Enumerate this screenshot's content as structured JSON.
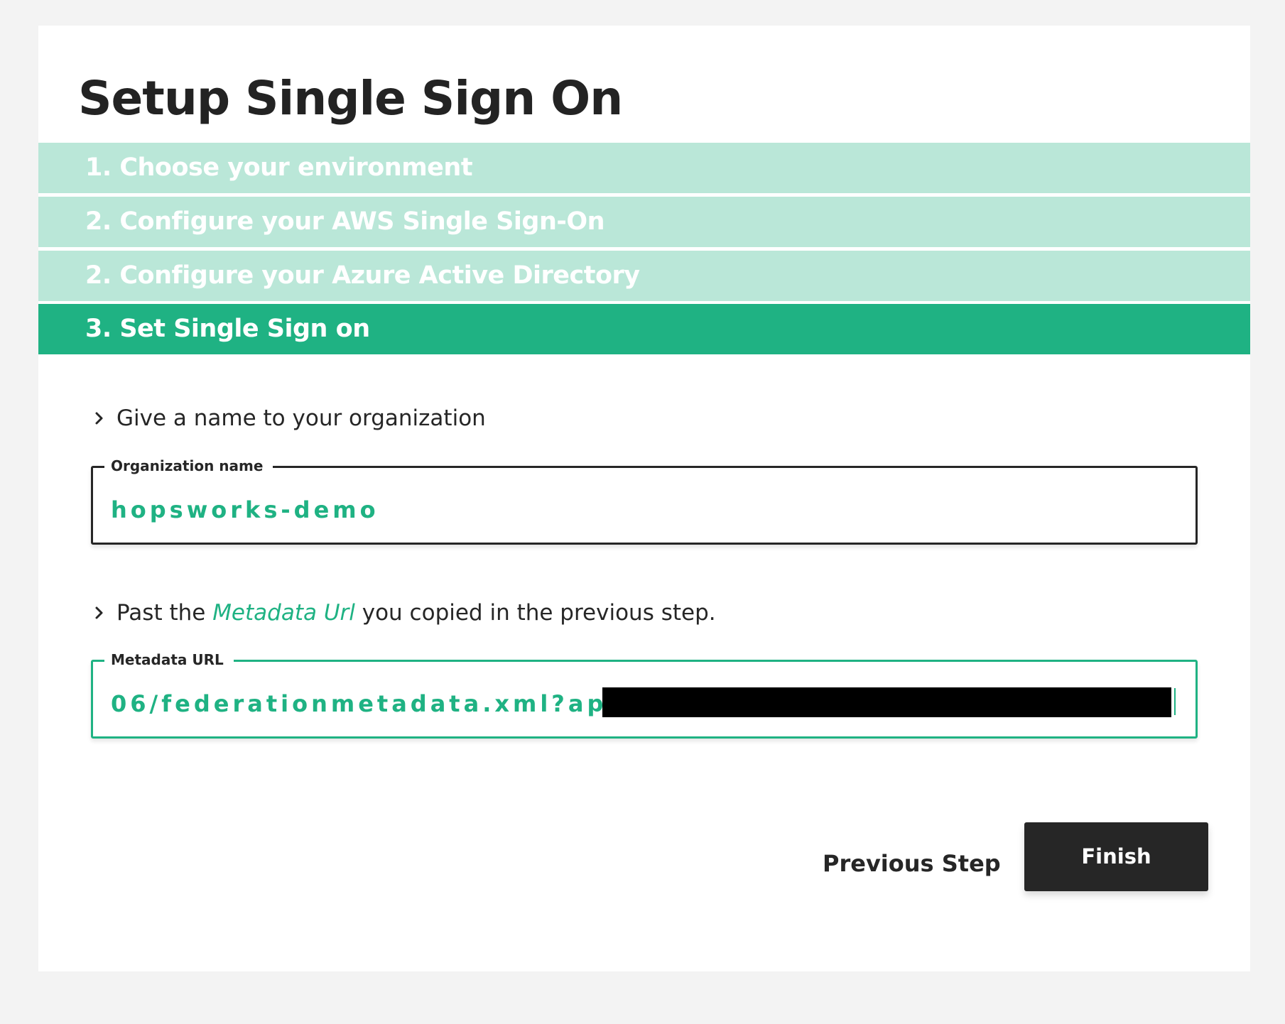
{
  "page": {
    "title": "Setup Single Sign On"
  },
  "steps": [
    {
      "label": "1. Choose your environment",
      "state": "inactive"
    },
    {
      "label": "2. Configure your AWS Single Sign-On",
      "state": "inactive"
    },
    {
      "label": "2. Configure your Azure Active Directory",
      "state": "inactive"
    },
    {
      "label": "3. Set Single Sign on",
      "state": "active"
    }
  ],
  "org_section": {
    "instruction": "Give a name to your organization",
    "field_label": "Organization name",
    "field_value": "hopsworks-demo"
  },
  "metadata_section": {
    "instruction_before": "Past the ",
    "instruction_highlight": "Metadata Url",
    "instruction_after": " you copied in the previous step.",
    "field_label": "Metadata URL",
    "field_value": "06/federationmetadata.xml?appid=a"
  },
  "actions": {
    "previous_label": "Previous Step",
    "finish_label": "Finish"
  },
  "icons": {
    "instruction_marker": "chevron-right-icon"
  },
  "colors": {
    "accent": "#1fb283",
    "step_inactive": "#bae7d8",
    "dark": "#262626",
    "background": "#f3f3f3"
  }
}
